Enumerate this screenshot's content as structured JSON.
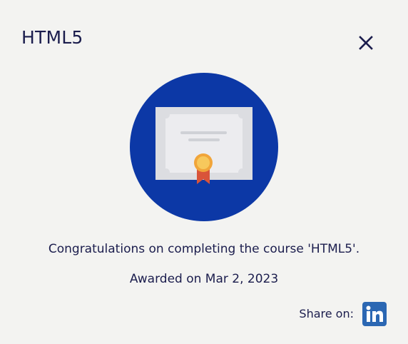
{
  "dialog": {
    "title": "HTML5",
    "close_icon": "close-icon"
  },
  "badge": {
    "icon": "certificate-icon",
    "circle_color": "#0c38a6",
    "paper_color": "#dcdde1",
    "ribbon_color": "#d9543a",
    "medal_color": "#f4b73c"
  },
  "message": "Congratulations on completing the course 'HTML5'.",
  "awarded": "Awarded on Mar 2, 2023",
  "share": {
    "label": "Share on:",
    "linkedin_icon": "linkedin-icon",
    "linkedin_color": "#2b67b3"
  }
}
